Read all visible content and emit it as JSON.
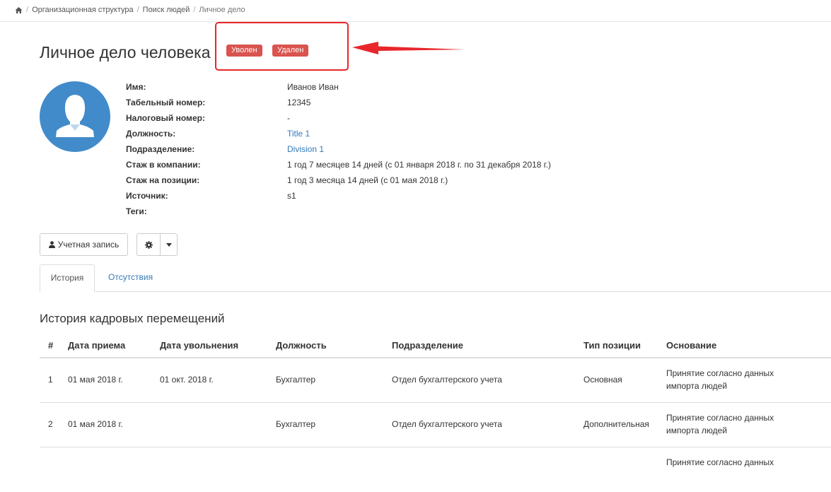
{
  "breadcrumb": {
    "home_icon": "home-icon",
    "items": [
      "Организационная структура",
      "Поиск людей",
      "Личное дело"
    ],
    "separator": "/"
  },
  "page": {
    "title": "Личное дело человека",
    "badges": [
      "Уволен",
      "Удален"
    ],
    "badge_color": "#d9534f",
    "annotation_color": "#e8262b"
  },
  "profile": {
    "avatar_icon": "user-avatar-icon",
    "fields": [
      {
        "label": "Имя:",
        "value": "Иванов Иван"
      },
      {
        "label": "Табельный номер:",
        "value": "12345"
      },
      {
        "label": "Налоговый номер:",
        "value": "-"
      },
      {
        "label": "Должность:",
        "value": "Title 1"
      },
      {
        "label": "Подразделение:",
        "value": "Division 1"
      },
      {
        "label": "Стаж в компании:",
        "value": "1 год 7 месяцев 14 дней (с 01 января 2018 г. по 31 декабря 2018 г.)"
      },
      {
        "label": "Стаж на позиции:",
        "value": "1 год 3 месяца 14 дней (с 01 мая 2018 г.)"
      },
      {
        "label": "Источник:",
        "value": "s1"
      },
      {
        "label": "Теги:",
        "value": ""
      }
    ]
  },
  "actions": {
    "account_label": "Учетная запись",
    "account_icon": "user-icon",
    "settings_icon": "gear-icon",
    "caret_icon": "caret-down-icon"
  },
  "tabs": [
    {
      "label": "История",
      "active": true
    },
    {
      "label": "Отсутствия",
      "active": false
    }
  ],
  "history": {
    "title": "История кадровых перемещений",
    "columns": [
      "#",
      "Дата приема",
      "Дата увольнения",
      "Должность",
      "Подразделение",
      "Тип позиции",
      "Основание"
    ],
    "rows": [
      {
        "n": "1",
        "hire": "01 мая 2018 г.",
        "fire": "01 окт. 2018 г.",
        "position": "Бухгалтер",
        "division": "Отдел бухгалтерского учета",
        "type": "Основная",
        "basis_1": "Принятие согласно данных",
        "basis_2": "импорта людей"
      },
      {
        "n": "2",
        "hire": "01 мая 2018 г.",
        "fire": "",
        "position": "Бухгалтер",
        "division": "Отдел бухгалтерского учета",
        "type": "Дополнительная",
        "basis_1": "Принятие согласно данных",
        "basis_2": "импорта людей"
      },
      {
        "n": "",
        "hire": "",
        "fire": "",
        "position": "",
        "division": "",
        "type": "",
        "basis_1": "Принятие согласно данных",
        "basis_2": ""
      }
    ]
  }
}
